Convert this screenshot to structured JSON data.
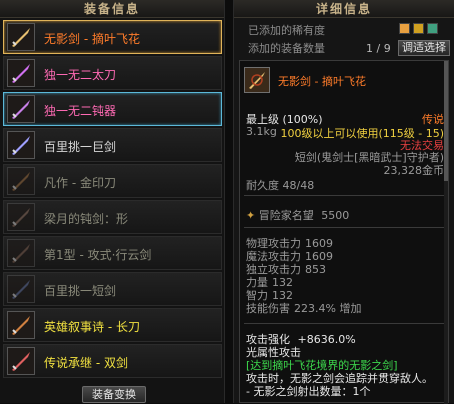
{
  "left_panel": {
    "header": "装备信息",
    "items": [
      {
        "name": "无影剑 - 摘叶飞花",
        "rarity": "legend",
        "state": "selected",
        "icon": "ghost-sword-icon"
      },
      {
        "name": "独一无二太刀",
        "rarity": "unique",
        "state": "normal",
        "icon": "katana-icon"
      },
      {
        "name": "独一无二钝器",
        "rarity": "unique",
        "state": "highlight",
        "icon": "blunt-icon"
      },
      {
        "name": "百里挑一巨剑",
        "rarity": "ancient",
        "state": "normal",
        "icon": "greatsword-icon"
      },
      {
        "name": "凡作 - 金印刀",
        "rarity": "common",
        "state": "dim",
        "icon": "broad-blade-icon"
      },
      {
        "name": "梁月的钝剑：形",
        "rarity": "common",
        "state": "dim",
        "icon": "blunt-sword-icon"
      },
      {
        "name": "第1型 - 攻式·行云剑",
        "rarity": "common",
        "state": "dim",
        "icon": "cloud-sword-icon"
      },
      {
        "name": "百里挑一短剑",
        "rarity": "common",
        "state": "dim",
        "icon": "short-sword-icon"
      },
      {
        "name": "英雄叙事诗 - 长刀",
        "rarity": "epic",
        "state": "normal",
        "icon": "longblade-icon"
      },
      {
        "name": "传说承继 - 双剑",
        "rarity": "epic",
        "state": "normal",
        "icon": "twin-sword-icon"
      }
    ],
    "bottom_button": "装备变换"
  },
  "right_panel": {
    "header": "详细信息",
    "rarity_filter_label": "已添加的稀有度",
    "added_count_label": "添加的装备数量",
    "added_count": "1 / 9",
    "adjust_button": "调适选择",
    "filter_colors": [
      "#e8a040",
      "#d0a020",
      "#40a080"
    ]
  },
  "detail": {
    "name": "无影剑 - 摘叶飞花",
    "level": "最上级 (100%)",
    "rarity": "传说",
    "weight": "3.1kg",
    "level_req": "100级以上可以使用(115级 - 15)",
    "trade": "无法交易",
    "type": "短剑(鬼剑士[黑暗武士]守护者)",
    "price": "23,328金币",
    "durability": "耐久度 48/48",
    "fame_label": "冒险家名望",
    "fame_value": "5500",
    "stats": [
      {
        "label": "物理攻击力",
        "value": "1609"
      },
      {
        "label": "魔法攻击力",
        "value": "1609"
      },
      {
        "label": "独立攻击力",
        "value": "853"
      },
      {
        "label": "力量",
        "value": "132"
      },
      {
        "label": "智力",
        "value": "132"
      },
      {
        "label": "技能伤害",
        "value": "223.4% 增加"
      }
    ],
    "attack_boost_label": "攻击强化",
    "attack_boost_value": "+8636.0%",
    "element": "光属性攻击",
    "set_line": "[达到摘叶飞花境界的无影之剑]",
    "desc1": "攻击时，无影之剑会追踪并贯穿敌人。",
    "desc2": "- 无影之剑射出数量：1个"
  }
}
